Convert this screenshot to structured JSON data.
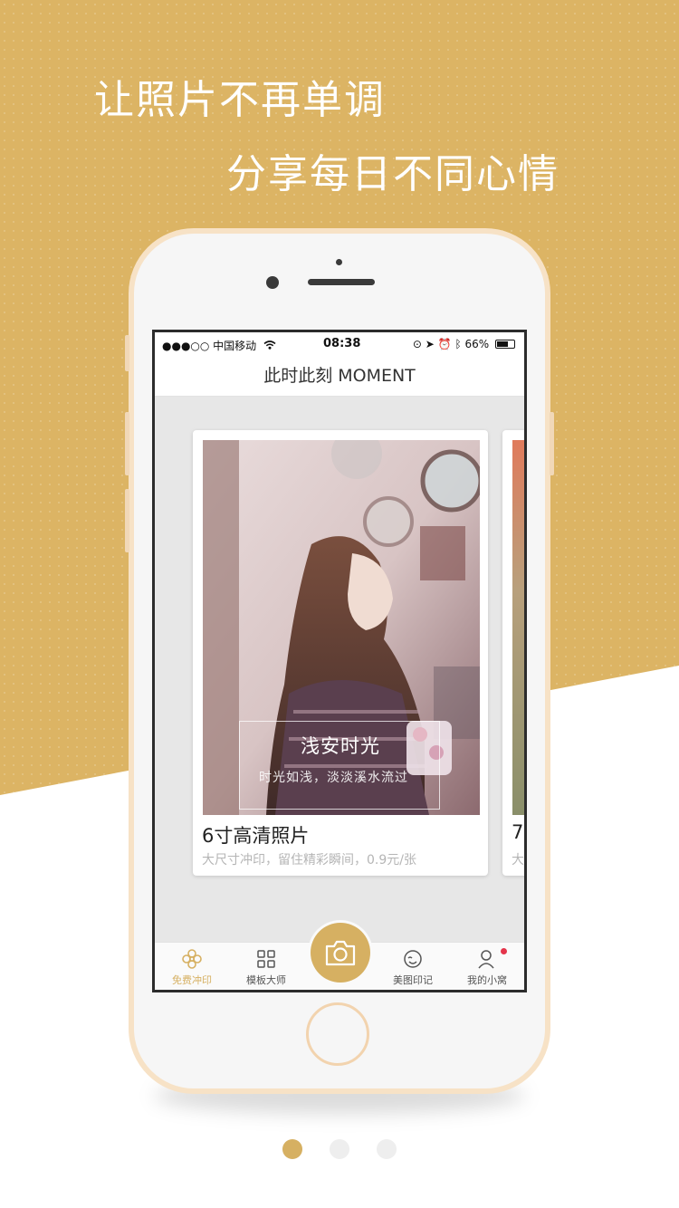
{
  "headline": {
    "line1": "让照片不再单调",
    "line2": "分享每日不同心情"
  },
  "status_bar": {
    "carrier": "●●●○○ 中国移动",
    "time": "08:38",
    "battery_text": "66%",
    "battery_level": 0.66
  },
  "nav": {
    "title": "此时此刻 MOMENT"
  },
  "cards": [
    {
      "overlay_title": "浅安时光",
      "overlay_subtitle": "时光如浅，淡淡溪水流过",
      "title": "6寸高清照片",
      "description": "大尺寸冲印，留住精彩瞬间，0.9元/张"
    },
    {
      "title": "7",
      "description": "大"
    }
  ],
  "tabbar": {
    "items": [
      {
        "label": "免费冲印",
        "icon": "flower-icon",
        "active": true
      },
      {
        "label": "模板大师",
        "icon": "grid-icon",
        "active": false
      },
      {
        "label": "美图印记",
        "icon": "face-icon",
        "active": false
      },
      {
        "label": "我的小窝",
        "icon": "user-icon",
        "active": false,
        "badge": true
      }
    ],
    "center_button_icon": "camera-icon"
  },
  "pagination": {
    "total": 3,
    "active_index": 0
  },
  "colors": {
    "gold": "#dcb464",
    "accent": "#d6b062",
    "phone_frame": "#f7e2c6",
    "badge": "#e4344a"
  }
}
